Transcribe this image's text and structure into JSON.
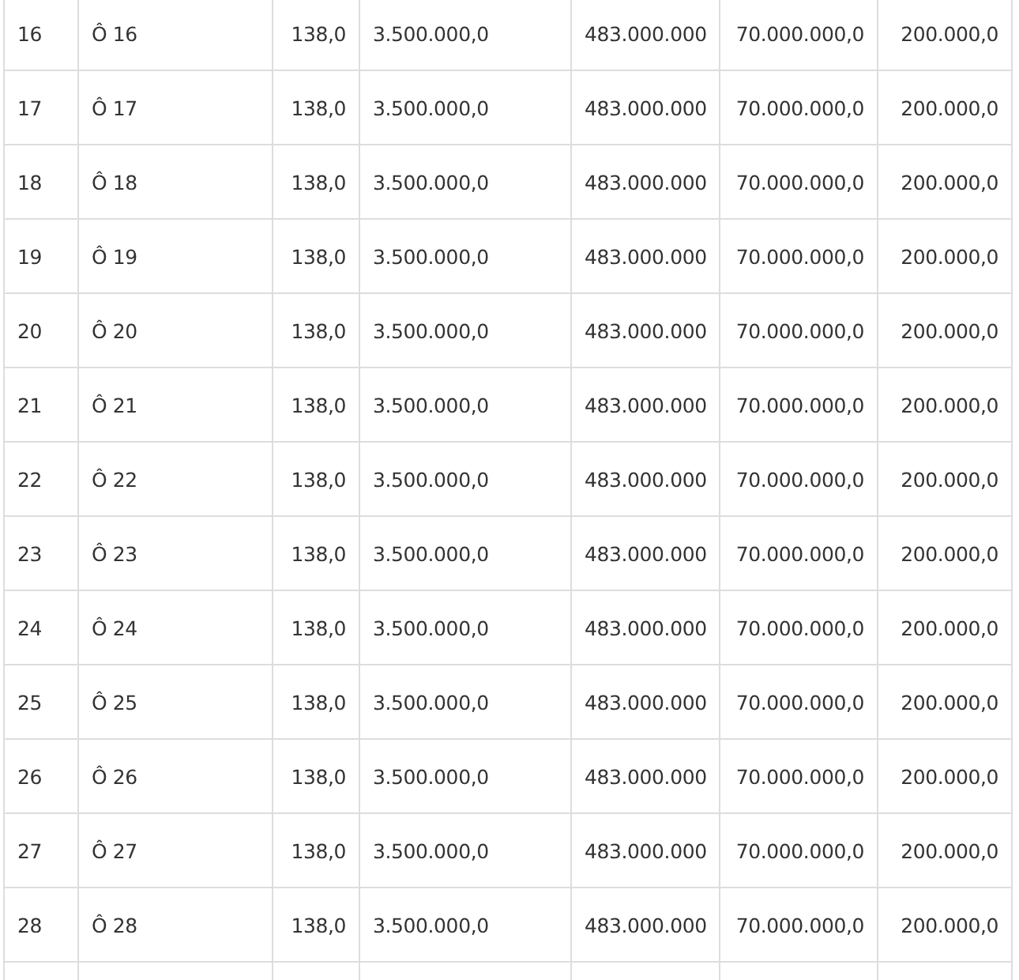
{
  "table": {
    "rows": [
      [
        "16",
        "Ô 16",
        "138,0",
        "3.500.000,0",
        "483.000.000",
        "70.000.000,0",
        "200.000,0"
      ],
      [
        "17",
        "Ô 17",
        "138,0",
        "3.500.000,0",
        "483.000.000",
        "70.000.000,0",
        "200.000,0"
      ],
      [
        "18",
        "Ô 18",
        "138,0",
        "3.500.000,0",
        "483.000.000",
        "70.000.000,0",
        "200.000,0"
      ],
      [
        "19",
        "Ô 19",
        "138,0",
        "3.500.000,0",
        "483.000.000",
        "70.000.000,0",
        "200.000,0"
      ],
      [
        "20",
        "Ô 20",
        "138,0",
        "3.500.000,0",
        "483.000.000",
        "70.000.000,0",
        "200.000,0"
      ],
      [
        "21",
        "Ô 21",
        "138,0",
        "3.500.000,0",
        "483.000.000",
        "70.000.000,0",
        "200.000,0"
      ],
      [
        "22",
        "Ô 22",
        "138,0",
        "3.500.000,0",
        "483.000.000",
        "70.000.000,0",
        "200.000,0"
      ],
      [
        "23",
        "Ô 23",
        "138,0",
        "3.500.000,0",
        "483.000.000",
        "70.000.000,0",
        "200.000,0"
      ],
      [
        "24",
        "Ô 24",
        "138,0",
        "3.500.000,0",
        "483.000.000",
        "70.000.000,0",
        "200.000,0"
      ],
      [
        "25",
        "Ô 25",
        "138,0",
        "3.500.000,0",
        "483.000.000",
        "70.000.000,0",
        "200.000,0"
      ],
      [
        "26",
        "Ô 26",
        "138,0",
        "3.500.000,0",
        "483.000.000",
        "70.000.000,0",
        "200.000,0"
      ],
      [
        "27",
        "Ô 27",
        "138,0",
        "3.500.000,0",
        "483.000.000",
        "70.000.000,0",
        "200.000,0"
      ],
      [
        "28",
        "Ô 28",
        "138,0",
        "3.500.000,0",
        "483.000.000",
        "70.000.000,0",
        "200.000,0"
      ]
    ]
  }
}
